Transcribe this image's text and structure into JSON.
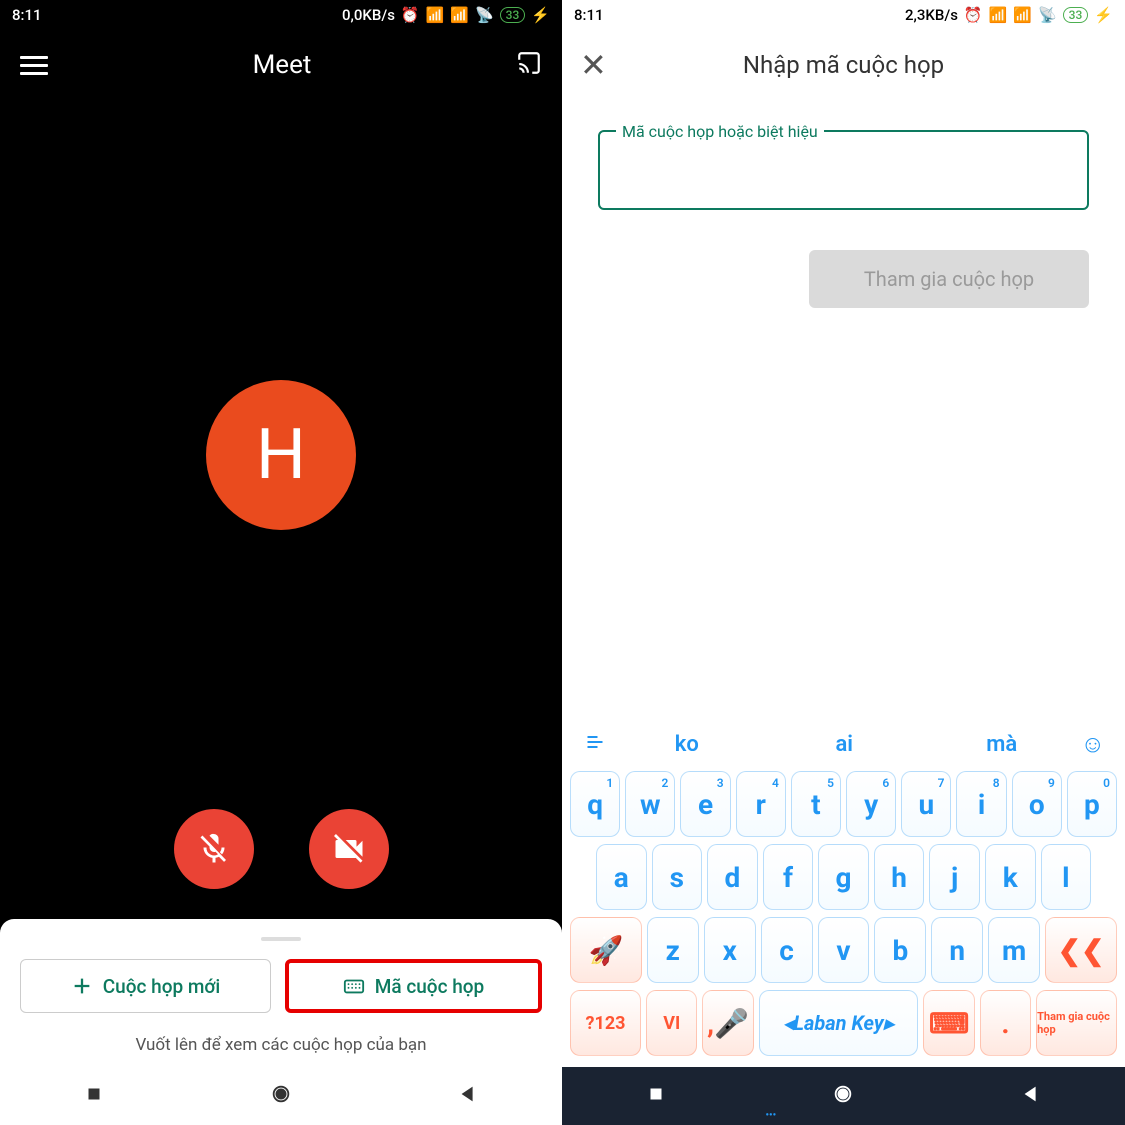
{
  "left": {
    "status": {
      "time": "8:11",
      "speed": "0,0KB/s",
      "battery": "33"
    },
    "header": {
      "title": "Meet"
    },
    "avatar_letter": "H",
    "actions": {
      "new": "Cuộc họp mới",
      "code": "Mã cuộc họp"
    },
    "hint": "Vuốt lên để xem các cuộc họp của bạn"
  },
  "right": {
    "status": {
      "time": "8:11",
      "speed": "2,3KB/s",
      "battery": "33"
    },
    "header": {
      "title": "Nhập mã cuộc họp"
    },
    "input_label": "Mã cuộc họp hoặc biệt hiệu",
    "join_label": "Tham gia cuộc họp",
    "suggestions": [
      "ko",
      "ai",
      "mà"
    ],
    "keys_r1": [
      [
        "q",
        "1"
      ],
      [
        "w",
        "2"
      ],
      [
        "e",
        "3"
      ],
      [
        "r",
        "4"
      ],
      [
        "t",
        "5"
      ],
      [
        "y",
        "6"
      ],
      [
        "u",
        "7"
      ],
      [
        "i",
        "8"
      ],
      [
        "o",
        "9"
      ],
      [
        "p",
        "0"
      ]
    ],
    "keys_r2": [
      "a",
      "s",
      "d",
      "f",
      "g",
      "h",
      "j",
      "k",
      "l"
    ],
    "keys_r3": [
      "z",
      "x",
      "c",
      "v",
      "b",
      "n",
      "m"
    ],
    "bottom": {
      "num": "?123",
      "lang": "VI",
      "space": "Laban Key",
      "join": "Tham gia cuộc họp"
    }
  }
}
